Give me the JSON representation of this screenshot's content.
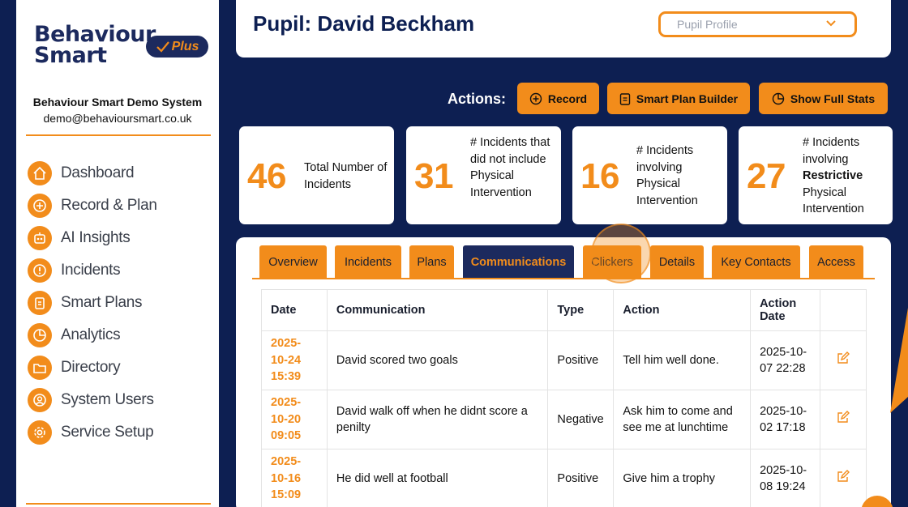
{
  "sidebar": {
    "logo_line1": "Behaviour",
    "logo_line2": "Smart",
    "logo_badge": "Plus",
    "system_name": "Behaviour Smart Demo System",
    "system_email": "demo@behavioursmart.co.uk",
    "items": [
      {
        "label": "Dashboard",
        "icon": "home-icon"
      },
      {
        "label": "Record & Plan",
        "icon": "plus-circle-icon"
      },
      {
        "label": "AI Insights",
        "icon": "robot-icon"
      },
      {
        "label": "Incidents",
        "icon": "alert-icon"
      },
      {
        "label": "Smart Plans",
        "icon": "clipboard-icon"
      },
      {
        "label": "Analytics",
        "icon": "pie-chart-icon"
      },
      {
        "label": "Directory",
        "icon": "folder-icon"
      },
      {
        "label": "System Users",
        "icon": "user-icon"
      },
      {
        "label": "Service Setup",
        "icon": "gear-icon"
      }
    ]
  },
  "header": {
    "title": "Pupil: David Beckham",
    "profile_select": "Pupil Profile"
  },
  "actions": {
    "label": "Actions:",
    "record": "Record",
    "smart_plan_builder": "Smart Plan Builder",
    "show_full_stats": "Show Full Stats"
  },
  "stats": [
    {
      "value": "46",
      "label": "Total Number of Incidents"
    },
    {
      "value": "31",
      "label": "# Incidents that did not include Physical Intervention"
    },
    {
      "value": "16",
      "label": "# Incidents involving Physical Intervention"
    },
    {
      "value": "27",
      "label_before": "# Incidents involving",
      "label_bold": "Restrictive",
      "label_after": "Physical Intervention"
    }
  ],
  "tabs": [
    "Overview",
    "Incidents",
    "Plans",
    "Communications",
    "Clickers",
    "Details",
    "Key Contacts",
    "Access"
  ],
  "active_tab": "Communications",
  "table": {
    "headers": [
      "Date",
      "Communication",
      "Type",
      "Action",
      "Action Date",
      ""
    ],
    "rows": [
      {
        "date": "2025-10-24 15:39",
        "communication": "David scored two goals",
        "type": "Positive",
        "action": "Tell him well done.",
        "action_date": "2025-10-07 22:28"
      },
      {
        "date": "2025-10-20 09:05",
        "communication": "David walk off when he didnt score a penilty",
        "type": "Negative",
        "action": "Ask him to come and see me at lunchtime",
        "action_date": "2025-10-02 17:18"
      },
      {
        "date": "2025-10-16 15:09",
        "communication": "He did well at football",
        "type": "Positive",
        "action": "Give him a trophy",
        "action_date": "2025-10-08 19:24"
      }
    ]
  },
  "colors": {
    "accent": "#f28c1b",
    "navy": "#0d1f52",
    "navy_light": "#1c2a5e"
  }
}
